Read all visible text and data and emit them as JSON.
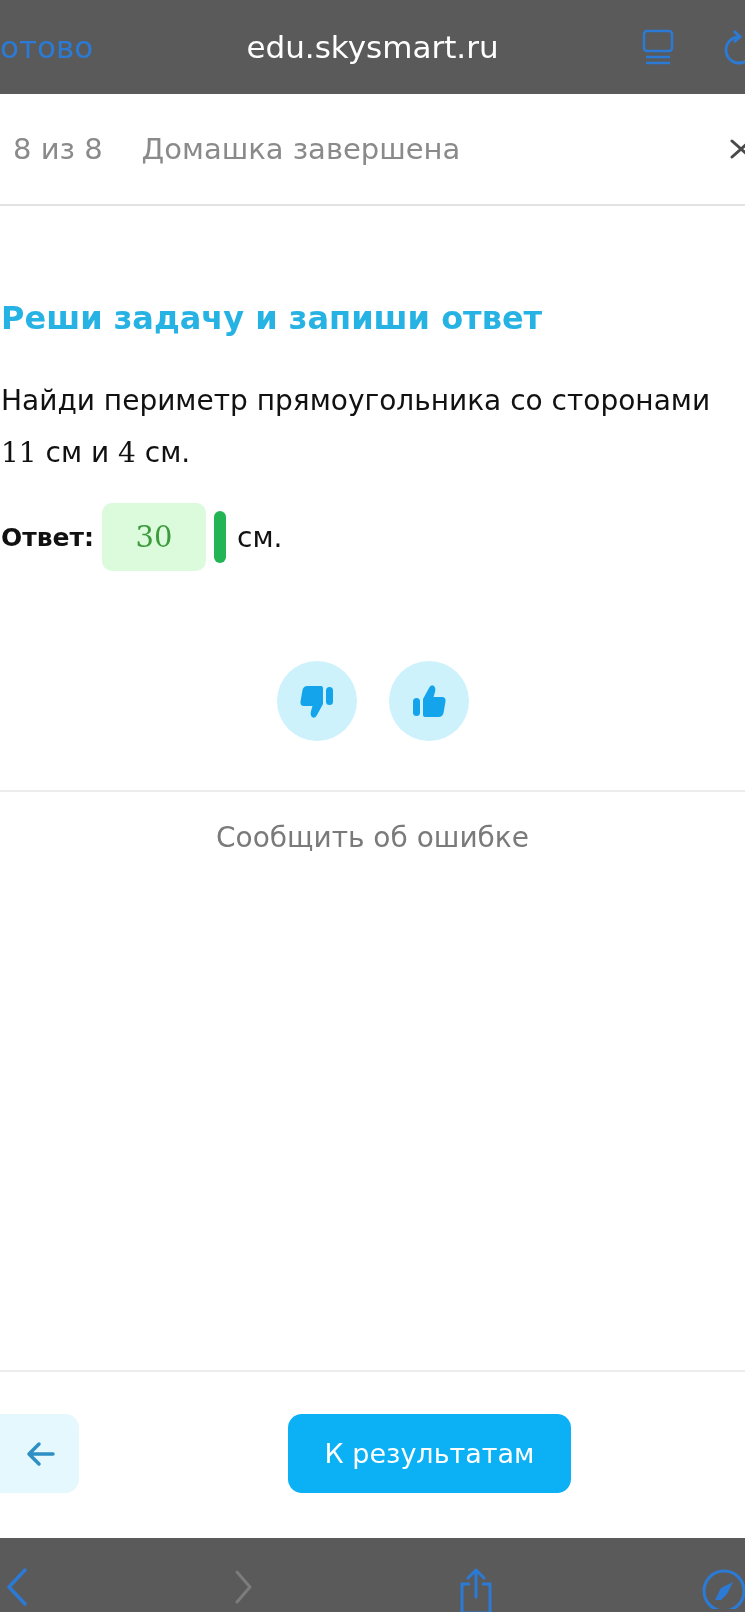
{
  "browser": {
    "done_label": "отово",
    "url": "edu.skysmart.ru"
  },
  "header": {
    "progress": "8 из 8",
    "status": "Домашка завершена"
  },
  "task": {
    "title": "Реши задачу и запиши ответ",
    "question": [
      {
        "kind": "text",
        "text": "Найди периметр прямоугольника со сторонами "
      },
      {
        "kind": "math",
        "text": "11"
      },
      {
        "kind": "text",
        "text": " см и "
      },
      {
        "kind": "math",
        "text": "4"
      },
      {
        "kind": "text",
        "text": " см."
      }
    ],
    "answer": {
      "label": "Ответ:",
      "value": "30",
      "correct": true,
      "unit": "см."
    }
  },
  "feedback": [
    {
      "kind": "dislike",
      "selected": false
    },
    {
      "kind": "like",
      "selected": false
    }
  ],
  "report_link": "Сообщить об ошибке",
  "footer": {
    "results_button": "К результатам"
  },
  "browser_toolbar": [
    {
      "kind": "back",
      "disabled": false
    },
    {
      "kind": "forward",
      "disabled": true
    },
    {
      "kind": "share",
      "disabled": false
    },
    {
      "kind": "compass",
      "disabled": false
    }
  ]
}
